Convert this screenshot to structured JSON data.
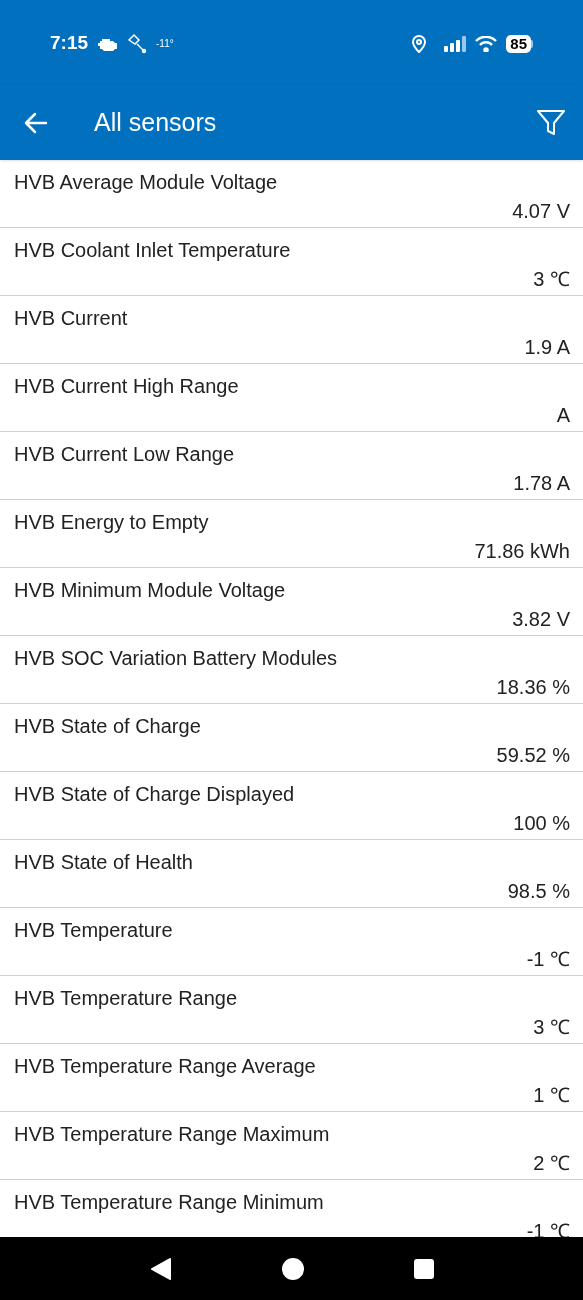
{
  "status_bar": {
    "time": "7:15",
    "temperature": "-11°",
    "battery": "85"
  },
  "app_bar": {
    "title": "All sensors"
  },
  "sensors": [
    {
      "name": "HVB Average Module Voltage",
      "value": "4.07 V"
    },
    {
      "name": "HVB Coolant Inlet Temperature",
      "value": "3 ℃"
    },
    {
      "name": "HVB Current",
      "value": "1.9 A"
    },
    {
      "name": "HVB Current High Range",
      "value": "A"
    },
    {
      "name": "HVB Current Low Range",
      "value": "1.78 A"
    },
    {
      "name": "HVB Energy to Empty",
      "value": "71.86 kWh"
    },
    {
      "name": "HVB Minimum Module Voltage",
      "value": "3.82 V"
    },
    {
      "name": "HVB SOC Variation Battery Modules",
      "value": "18.36 %"
    },
    {
      "name": "HVB State of Charge",
      "value": "59.52 %"
    },
    {
      "name": "HVB State of Charge Displayed",
      "value": "100 %"
    },
    {
      "name": "HVB State of Health",
      "value": "98.5 %"
    },
    {
      "name": "HVB Temperature",
      "value": "-1 ℃"
    },
    {
      "name": "HVB Temperature Range",
      "value": "3 ℃"
    },
    {
      "name": "HVB Temperature Range Average",
      "value": "1 ℃"
    },
    {
      "name": "HVB Temperature Range Maximum",
      "value": "2 ℃"
    },
    {
      "name": "HVB Temperature Range Minimum",
      "value": "-1 ℃"
    }
  ]
}
